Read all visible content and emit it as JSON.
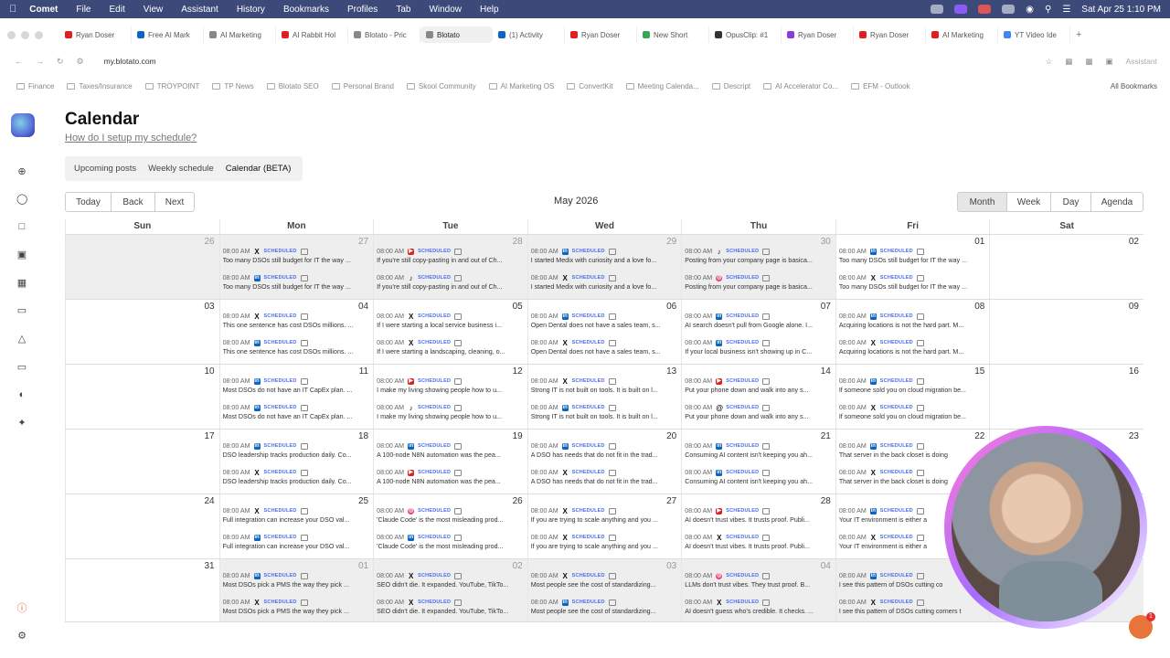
{
  "os_menubar": {
    "app": "Comet",
    "items": [
      "File",
      "Edit",
      "View",
      "Assistant",
      "History",
      "Bookmarks",
      "Profiles",
      "Tab",
      "Window",
      "Help"
    ],
    "clock": "Sat Apr 25  1:10 PM"
  },
  "browser_tabs": [
    {
      "label": "Ryan Doser",
      "color": "#e02020"
    },
    {
      "label": "Free AI Mark",
      "color": "#0a66c2"
    },
    {
      "label": "AI Marketing",
      "color": "#888888"
    },
    {
      "label": "AI Rabbit Hol",
      "color": "#e02020"
    },
    {
      "label": "Blotato - Pric",
      "color": "#888888"
    },
    {
      "label": "Blotato",
      "color": "#888888",
      "active": true
    },
    {
      "label": "(1) Activity",
      "color": "#0a66c2"
    },
    {
      "label": "Ryan Doser",
      "color": "#e02020"
    },
    {
      "label": "New Short",
      "color": "#34a853"
    },
    {
      "label": "OpusClip: #1",
      "color": "#333333"
    },
    {
      "label": "Ryan Doser",
      "color": "#8a3bd8"
    },
    {
      "label": "Ryan Doser",
      "color": "#e02020"
    },
    {
      "label": "AI Marketing",
      "color": "#e02020"
    },
    {
      "label": "YT Video Ide",
      "color": "#4285f4"
    }
  ],
  "url": "my.blotato.com",
  "assistant_label": "Assistant",
  "bookmarks": [
    "Finance",
    "Taxes/Insurance",
    "TROYPOINT",
    "TP News",
    "Blotato SEO",
    "Personal Brand",
    "Skool Community",
    "AI Marketing OS",
    "ConvertKit",
    "Meeting Calenda...",
    "Descript",
    "AI Accelerator Co...",
    "EFM - Outlook"
  ],
  "all_bookmarks": "All Bookmarks",
  "page": {
    "title": "Calendar",
    "setup_link": "How do I setup my schedule?",
    "subtabs": [
      "Upcoming posts",
      "Weekly schedule",
      "Calendar (BETA)"
    ],
    "nav": {
      "today": "Today",
      "back": "Back",
      "next": "Next"
    },
    "month": "May 2026",
    "views": [
      "Month",
      "Week",
      "Day",
      "Agenda"
    ],
    "weekdays": [
      "Sun",
      "Mon",
      "Tue",
      "Wed",
      "Thu",
      "Fri",
      "Sat"
    ]
  },
  "event_meta": {
    "time": "08:00 AM",
    "status": "SCHEDULED"
  },
  "weeks": [
    {
      "days": [
        {
          "n": "26",
          "off": true,
          "events": []
        },
        {
          "n": "27",
          "off": true,
          "events": [
            {
              "i": "x",
              "t": "Too many DSOs still budget for IT the way ..."
            },
            {
              "i": "li",
              "t": "Too many DSOs still budget for IT the way ..."
            }
          ]
        },
        {
          "n": "28",
          "off": true,
          "events": [
            {
              "i": "yt",
              "t": "If you're still copy-pasting in and out of Ch..."
            },
            {
              "i": "tt",
              "t": "If you're still copy-pasting in and out of Ch..."
            }
          ]
        },
        {
          "n": "29",
          "off": true,
          "events": [
            {
              "i": "li",
              "t": "I started Medix with curiosity and a love fo..."
            },
            {
              "i": "x",
              "t": "I started Medix with curiosity and a love fo..."
            }
          ]
        },
        {
          "n": "30",
          "off": true,
          "events": [
            {
              "i": "tt",
              "t": "Posting from your company page is basica..."
            },
            {
              "i": "ig",
              "t": "Posting from your company page is basica..."
            }
          ]
        },
        {
          "n": "01",
          "off": false,
          "events": [
            {
              "i": "li",
              "t": "Too many DSOs still budget for IT the way ..."
            },
            {
              "i": "x",
              "t": "Too many DSOs still budget for IT the way ..."
            }
          ]
        },
        {
          "n": "02",
          "off": false,
          "events": []
        }
      ]
    },
    {
      "days": [
        {
          "n": "03",
          "events": []
        },
        {
          "n": "04",
          "events": [
            {
              "i": "x",
              "t": "This one sentence has cost DSOs millions. ..."
            },
            {
              "i": "li",
              "t": "This one sentence has cost DSOs millions. ..."
            }
          ]
        },
        {
          "n": "05",
          "events": [
            {
              "i": "x",
              "t": "If I were starting a local service business i..."
            },
            {
              "i": "x",
              "t": "If I were starting a landscaping, cleaning, o..."
            }
          ]
        },
        {
          "n": "06",
          "events": [
            {
              "i": "li",
              "t": "Open Dental does not have a sales team, s..."
            },
            {
              "i": "x",
              "t": "Open Dental does not have a sales team, s..."
            }
          ]
        },
        {
          "n": "07",
          "events": [
            {
              "i": "li",
              "t": "AI search doesn't pull from Google alone. I..."
            },
            {
              "i": "li",
              "t": "If your local business isn't showing up in C..."
            }
          ]
        },
        {
          "n": "08",
          "events": [
            {
              "i": "li",
              "t": "Acquiring locations is not the hard part. M..."
            },
            {
              "i": "x",
              "t": "Acquiring locations is not the hard part. M..."
            }
          ]
        },
        {
          "n": "09",
          "events": []
        }
      ]
    },
    {
      "days": [
        {
          "n": "10",
          "events": []
        },
        {
          "n": "11",
          "events": [
            {
              "i": "li",
              "t": "Most DSOs do not have an IT CapEx plan. ..."
            },
            {
              "i": "li",
              "t": "Most DSOs do not have an IT CapEx plan. ..."
            }
          ]
        },
        {
          "n": "12",
          "events": [
            {
              "i": "yt",
              "t": "I make my living showing people how to u..."
            },
            {
              "i": "tt",
              "t": "I make my living showing people how to u..."
            }
          ]
        },
        {
          "n": "13",
          "events": [
            {
              "i": "x",
              "t": "Strong IT is not built on tools. It is built on l..."
            },
            {
              "i": "li",
              "t": "Strong IT is not built on tools. It is built on l..."
            }
          ]
        },
        {
          "n": "14",
          "events": [
            {
              "i": "yt",
              "t": "Put your phone down and walk into any s..."
            },
            {
              "i": "th",
              "t": "Put your phone down and walk into any s..."
            }
          ]
        },
        {
          "n": "15",
          "events": [
            {
              "i": "li",
              "t": "If someone sold you on cloud migration be..."
            },
            {
              "i": "x",
              "t": "If someone sold you on cloud migration be..."
            }
          ]
        },
        {
          "n": "16",
          "events": []
        }
      ]
    },
    {
      "days": [
        {
          "n": "17",
          "events": []
        },
        {
          "n": "18",
          "events": [
            {
              "i": "li",
              "t": "DSO leadership tracks production daily. Co..."
            },
            {
              "i": "x",
              "t": "DSO leadership tracks production daily. Co..."
            }
          ]
        },
        {
          "n": "19",
          "events": [
            {
              "i": "li",
              "t": "A 100-node N8N automation was the pea..."
            },
            {
              "i": "yt",
              "t": "A 100-node N8N automation was the pea..."
            }
          ]
        },
        {
          "n": "20",
          "events": [
            {
              "i": "li",
              "t": "A DSO has needs that do not fit in the trad..."
            },
            {
              "i": "x",
              "t": "A DSO has needs that do not fit in the trad..."
            }
          ]
        },
        {
          "n": "21",
          "events": [
            {
              "i": "li",
              "t": "Consuming AI content isn't keeping you ah..."
            },
            {
              "i": "li",
              "t": "Consuming AI content isn't keeping you ah..."
            }
          ]
        },
        {
          "n": "22",
          "events": [
            {
              "i": "li",
              "t": "That server in the back closet is doing"
            },
            {
              "i": "x",
              "t": "That server in the back closet is doing"
            }
          ]
        },
        {
          "n": "23",
          "events": []
        }
      ]
    },
    {
      "days": [
        {
          "n": "24",
          "events": []
        },
        {
          "n": "25",
          "events": [
            {
              "i": "x",
              "t": "Full integration can increase your DSO val..."
            },
            {
              "i": "li",
              "t": "Full integration can increase your DSO val..."
            }
          ]
        },
        {
          "n": "26",
          "events": [
            {
              "i": "ig",
              "t": "'Claude Code' is the most misleading prod..."
            },
            {
              "i": "li",
              "t": "'Claude Code' is the most misleading prod..."
            }
          ]
        },
        {
          "n": "27",
          "events": [
            {
              "i": "x",
              "t": "If you are trying to scale anything and you ..."
            },
            {
              "i": "x",
              "t": "If you are trying to scale anything and you ..."
            }
          ]
        },
        {
          "n": "28",
          "events": [
            {
              "i": "yt",
              "t": "AI doesn't trust vibes. It trusts proof. Publi..."
            },
            {
              "i": "x",
              "t": "AI doesn't trust vibes. It trusts proof. Publi..."
            }
          ]
        },
        {
          "n": "29",
          "events": [
            {
              "i": "li",
              "t": "Your IT environment is either a"
            },
            {
              "i": "x",
              "t": "Your IT environment is either a"
            }
          ]
        },
        {
          "n": "30",
          "events": []
        }
      ]
    },
    {
      "days": [
        {
          "n": "31",
          "events": []
        },
        {
          "n": "01",
          "off": true,
          "events": [
            {
              "i": "li",
              "t": "Most DSOs pick a PMS the way they pick ..."
            },
            {
              "i": "x",
              "t": "Most DSOs pick a PMS the way they pick ..."
            }
          ]
        },
        {
          "n": "02",
          "off": true,
          "events": [
            {
              "i": "x",
              "t": "SEO didn't die. It expanded. YouTube, TikTo..."
            },
            {
              "i": "x",
              "t": "SEO didn't die. It expanded. YouTube, TikTo..."
            }
          ]
        },
        {
          "n": "03",
          "off": true,
          "events": [
            {
              "i": "x",
              "t": "Most people see the cost of standardizing..."
            },
            {
              "i": "li",
              "t": "Most people see the cost of standardizing..."
            }
          ]
        },
        {
          "n": "04",
          "off": true,
          "events": [
            {
              "i": "ig",
              "t": "LLMs don't trust vibes. They trust proof. B..."
            },
            {
              "i": "x",
              "t": "AI doesn't guess who's credible. It checks. ..."
            }
          ]
        },
        {
          "n": "05",
          "off": true,
          "events": [
            {
              "i": "li",
              "t": "I see this pattern of DSOs cutting co"
            },
            {
              "i": "x",
              "t": "I see this pattern of DSOs cutting corners t"
            }
          ]
        },
        {
          "n": "06",
          "off": true,
          "events": []
        }
      ]
    }
  ],
  "chat_badge": "1"
}
